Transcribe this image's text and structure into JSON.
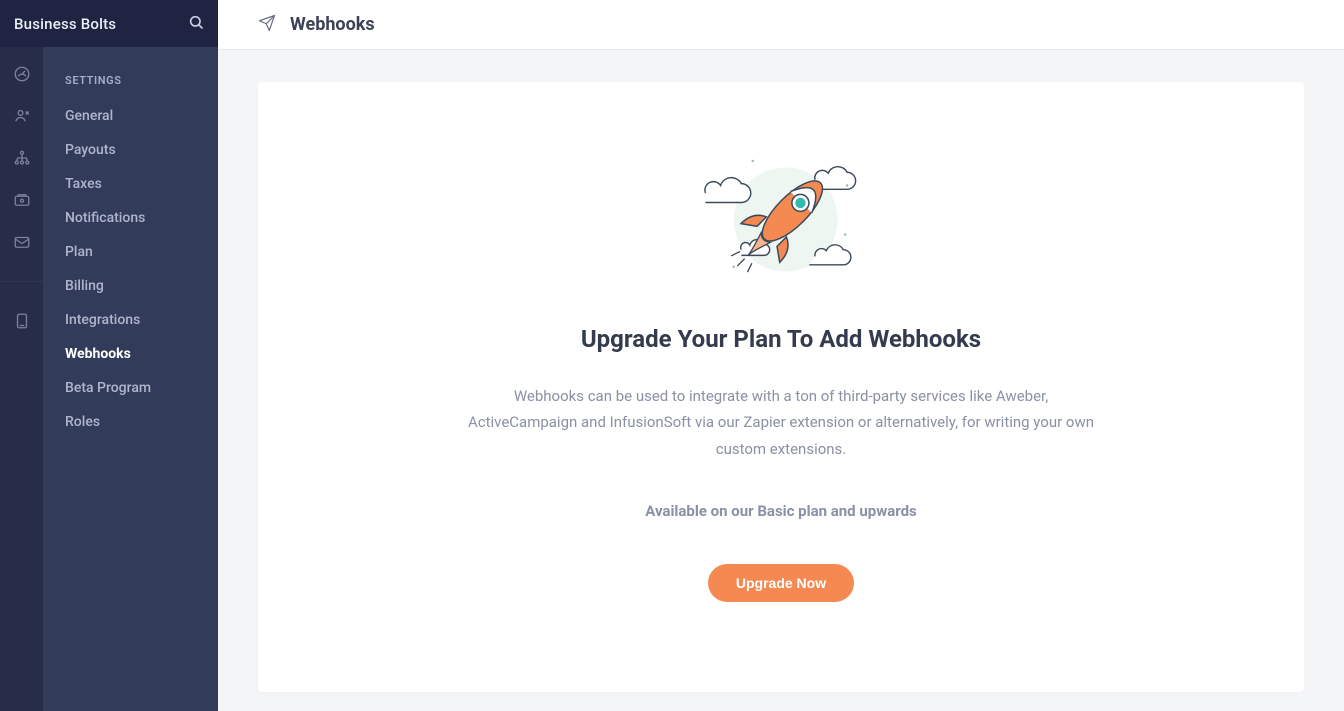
{
  "brand": "Business Bolts",
  "sidebar": {
    "section_label": "SETTINGS",
    "items": [
      {
        "label": "General",
        "active": false
      },
      {
        "label": "Payouts",
        "active": false
      },
      {
        "label": "Taxes",
        "active": false
      },
      {
        "label": "Notifications",
        "active": false
      },
      {
        "label": "Plan",
        "active": false
      },
      {
        "label": "Billing",
        "active": false
      },
      {
        "label": "Integrations",
        "active": false
      },
      {
        "label": "Webhooks",
        "active": true
      },
      {
        "label": "Beta Program",
        "active": false
      },
      {
        "label": "Roles",
        "active": false
      }
    ]
  },
  "page": {
    "title": "Webhooks"
  },
  "upgrade": {
    "heading": "Upgrade Your Plan To Add Webhooks",
    "body": "Webhooks can be used to integrate with a ton of third-party services like Aweber, ActiveCampaign and InfusionSoft via our Zapier extension or alternatively, for writing your own custom extensions.",
    "availability": "Available on our Basic plan and upwards",
    "button_label": "Upgrade Now"
  },
  "colors": {
    "accent": "#f48a52",
    "rail_bg": "#272c49",
    "sidebar_bg": "#323b5a",
    "brandbar_bg": "#1e2441"
  }
}
